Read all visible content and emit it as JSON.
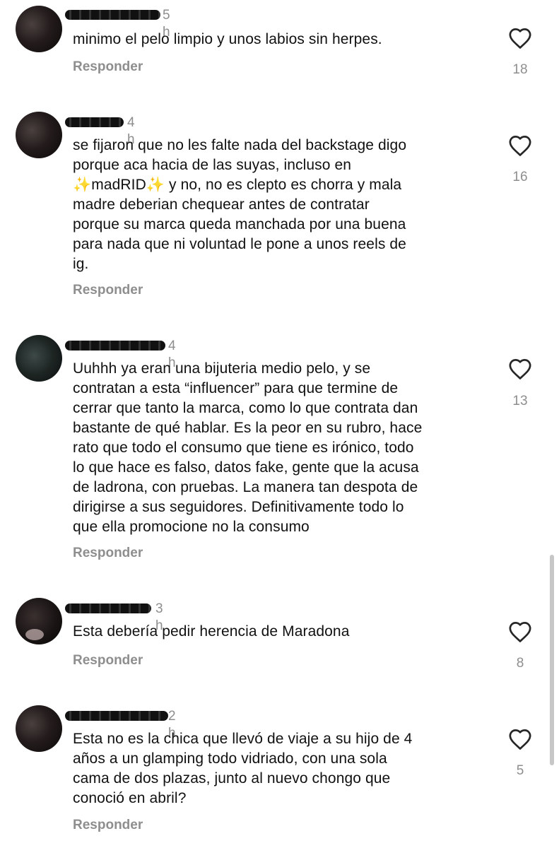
{
  "comments": [
    {
      "time": "5 h",
      "text": "minimo el pelo limpio y unos labios sin herpes.",
      "reply_label": "Responder",
      "likes": "18"
    },
    {
      "time": "4 h",
      "text": "se fijaron que no les falte nada del backstage digo\nporque aca hacia de las suyas, incluso en\n✨madRID✨ y no, no es clepto es chorra y mala\nmadre deberian chequear antes de contratar\nporque su marca queda manchada por una buena\npara nada que ni voluntad le pone a unos reels de\nig.",
      "reply_label": "Responder",
      "likes": "16"
    },
    {
      "time": "4 h",
      "text": "Uuhhh ya eran una bijuteria medio pelo, y se\ncontratan a esta “influencer” para que termine de\ncerrar que tanto la marca, como lo que contrata dan\nbastante de qué hablar. Es la peor en su rubro, hace\nrato que todo el consumo que tiene es irónico, todo\nlo que hace es falso, datos fake, gente que la acusa\nde ladrona, con pruebas. La manera tan despota de\ndirigirse a sus seguidores. Definitivamente todo lo\nque ella promocione no la consumo",
      "reply_label": "Responder",
      "likes": "13"
    },
    {
      "time": "3 h",
      "text": "Esta debería pedir herencia de Maradona",
      "reply_label": "Responder",
      "likes": "8"
    },
    {
      "time": "2 h",
      "text": "Esta no es la chica que llevó de viaje a su hijo de 4\naños a un glamping todo vidriado, con una sola\ncama de dos plazas, junto al nuevo chongo que\nconoció en abril?",
      "reply_label": "Responder",
      "likes": "5"
    }
  ],
  "icons": {
    "like": "heart-outline-icon",
    "avatar": "profile-avatar"
  },
  "colors": {
    "text": "#111111",
    "secondary": "#8e8e8e",
    "background": "#ffffff"
  }
}
